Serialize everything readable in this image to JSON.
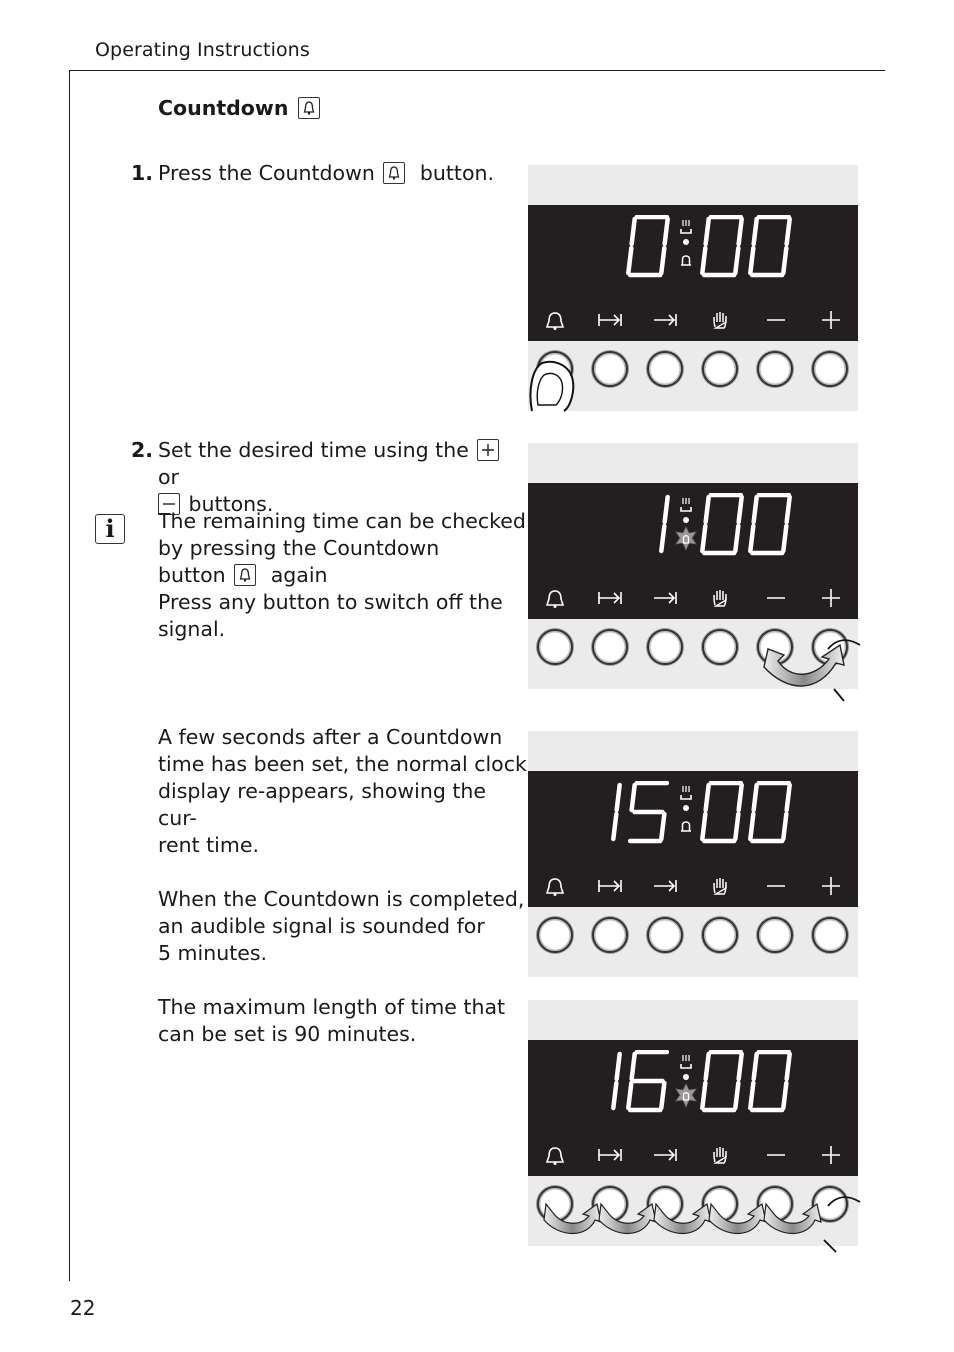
{
  "header": {
    "running_title": "Operating Instructions"
  },
  "page_number": "22",
  "section": {
    "title": "Countdown",
    "title_icon": "bell-icon"
  },
  "steps": [
    {
      "number": "1.",
      "text_before": "Press the Countdown",
      "icon": "bell-icon",
      "text_after": "button."
    },
    {
      "number": "2.",
      "text_line1_before": "Set the desired time using the",
      "icon_plus": "plus-box-icon",
      "text_or": "or",
      "icon_minus": "minus-box-icon",
      "text_line2_after": "buttons."
    }
  ],
  "info_note": {
    "icon": "info-icon",
    "icon_glyph": "i",
    "line1": "The remaining time can be checked",
    "line2": "by pressing the Countdown",
    "line3_before": "button",
    "line3_after": "again",
    "line4": "Press any button to switch off the",
    "line5": "signal."
  },
  "paragraphs": [
    {
      "lines": [
        "A few seconds after a Countdown",
        "time has been set, the normal clock",
        "display re-appears, showing the cur-",
        "rent time."
      ]
    },
    {
      "lines": [
        "When the Countdown is completed,",
        "an audible signal is sounded for",
        "5 minutes."
      ]
    },
    {
      "lines": [
        "The maximum length of time that",
        "can be set is 90 minutes."
      ]
    }
  ],
  "panel_buttons": [
    {
      "name": "countdown",
      "icon": "bell-icon"
    },
    {
      "name": "end-time",
      "icon": "end-time-icon"
    },
    {
      "name": "cooking-time",
      "icon": "arrow-to-bar-icon"
    },
    {
      "name": "manual",
      "icon": "hand-icon"
    },
    {
      "name": "minus",
      "icon": "minus-icon"
    },
    {
      "name": "plus",
      "icon": "plus-icon"
    }
  ],
  "displays": [
    {
      "label": "display-step-1",
      "time": "0:00",
      "bell_state": "on",
      "action": "press countdown button"
    },
    {
      "label": "display-step-2",
      "time": "1:00",
      "bell_state": "flashing",
      "action": "press minus/plus buttons"
    },
    {
      "label": "display-step-3",
      "time": "15:00",
      "bell_state": "on",
      "action": "none"
    },
    {
      "label": "display-step-4",
      "time": "16:00",
      "bell_state": "flashing",
      "action": "press any button"
    }
  ]
}
